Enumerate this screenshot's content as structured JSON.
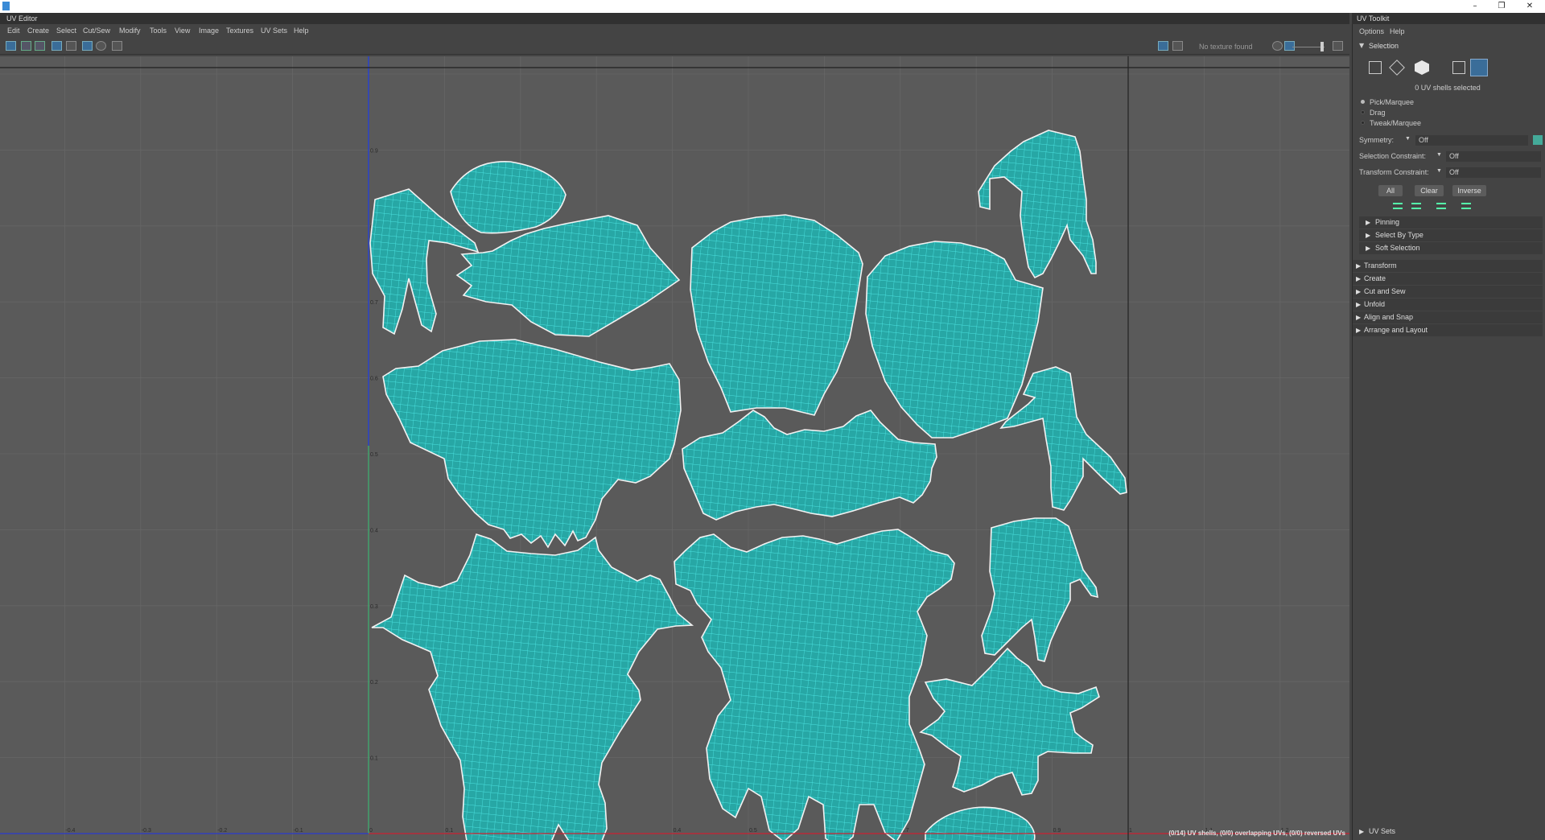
{
  "window": {
    "title": "",
    "controls": [
      "–",
      "❐",
      "✕"
    ]
  },
  "editor": {
    "title": "UV Editor",
    "menu": [
      "Edit",
      "Create",
      "Select",
      "Cut/Sew",
      "Modify",
      "Tools",
      "View",
      "Image",
      "Textures",
      "UV Sets",
      "Help"
    ],
    "texture_status": "No texture found",
    "status_line": "(0/14) UV shells, (0/0) overlapping UVs, (0/0) reversed UVs",
    "axis_labels_bottom": [
      "-0.4",
      "-0.3",
      "-0.2",
      "-0.1",
      "0",
      "0.1",
      "0.2",
      "0.3",
      "0.4",
      "0.5",
      "0.6",
      "0.7",
      "0.8",
      "0.9",
      "1",
      "1.1",
      "1.2"
    ],
    "axis_labels_left": [
      "0.9",
      "0.8",
      "0.7",
      "0.6",
      "0.5",
      "0.4",
      "0.3",
      "0.2",
      "0.1"
    ],
    "colors": {
      "background": "#5a5a5a",
      "grid": "#666666",
      "shell_fill": "#27a7a5",
      "wire": "#47e1e0",
      "border": "#f0f0f0"
    }
  },
  "toolkit": {
    "title": "UV Toolkit",
    "menu": [
      "Options",
      "Help"
    ],
    "selection": {
      "header": "Selection",
      "count_text": "0 UV shells selected",
      "modes": [
        "Pick/Marquee",
        "Drag",
        "Tweak/Marquee"
      ],
      "symmetry_label": "Symmetry:",
      "symmetry_value": "Off",
      "selection_constraint_label": "Selection Constraint:",
      "selection_constraint_value": "Off",
      "transform_constraint_label": "Transform Constraint:",
      "transform_constraint_value": "Off",
      "buttons": [
        "All",
        "Clear",
        "Inverse"
      ]
    },
    "sub_sections": [
      "Pinning",
      "Select By Type",
      "Soft Selection"
    ],
    "sections": [
      "Transform",
      "Create",
      "Cut and Sew",
      "Unfold",
      "Align and Snap",
      "Arrange and Layout"
    ],
    "footer_section": "UV Sets"
  }
}
